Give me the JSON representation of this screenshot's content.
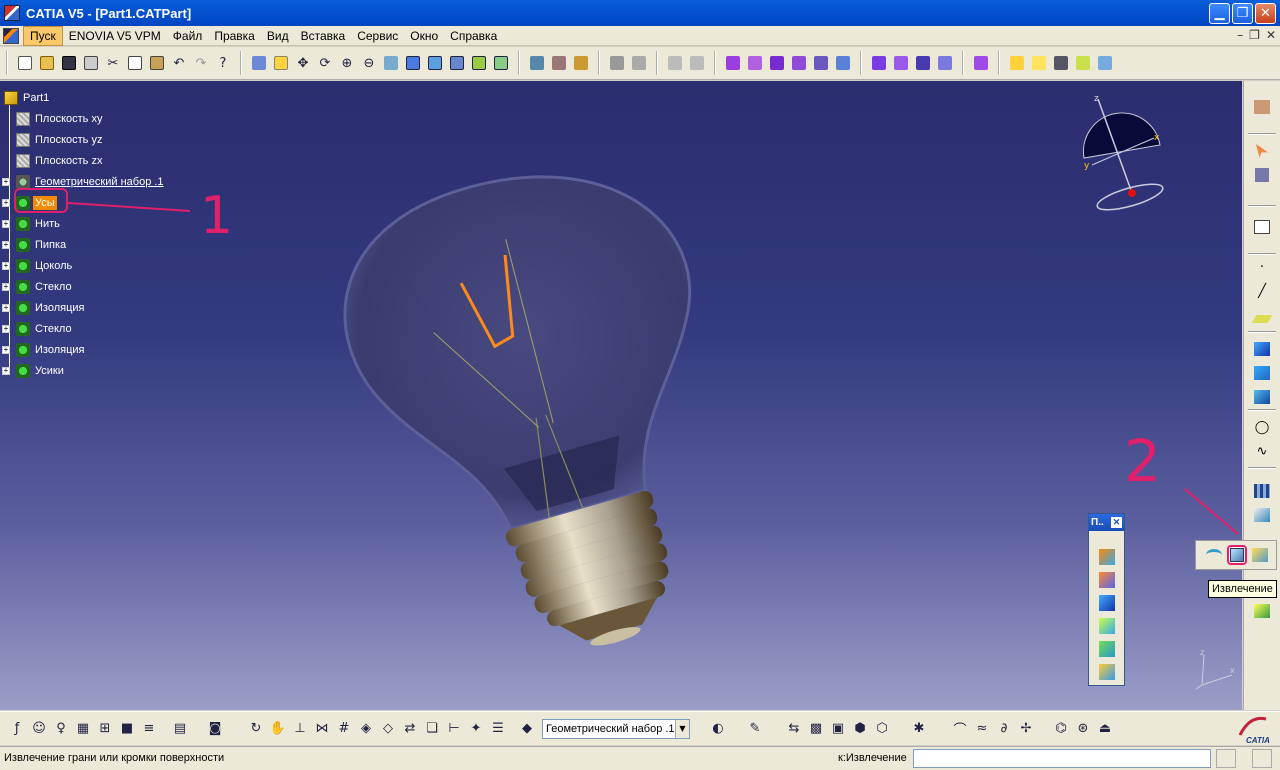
{
  "window": {
    "title": "CATIA V5 - [Part1.CATPart]",
    "buttons": {
      "minimize": "▁",
      "restore": "❐",
      "close": "✕"
    }
  },
  "menu": {
    "items": [
      "Пуск",
      "ENOVIA V5 VPM",
      "Файл",
      "Правка",
      "Вид",
      "Вставка",
      "Сервис",
      "Окно",
      "Справка"
    ],
    "active_index": 0,
    "mdi_buttons": [
      "–",
      "❐",
      "✕"
    ]
  },
  "tree": {
    "root": "Part1",
    "items": [
      {
        "label": "Плоскость xy",
        "kind": "plane"
      },
      {
        "label": "Плоскость yz",
        "kind": "plane"
      },
      {
        "label": "Плоскость zx",
        "kind": "plane"
      },
      {
        "label": "Геометрический набор .1",
        "kind": "geo",
        "underline": true
      },
      {
        "label": "Усы",
        "kind": "body",
        "selected": true
      },
      {
        "label": "Нить",
        "kind": "body"
      },
      {
        "label": "Пипка",
        "kind": "body"
      },
      {
        "label": "Цоколь",
        "kind": "body"
      },
      {
        "label": "Стекло",
        "kind": "body"
      },
      {
        "label": "Изоляция",
        "kind": "body"
      },
      {
        "label": "Стекло",
        "kind": "body"
      },
      {
        "label": "Изоляция",
        "kind": "body"
      },
      {
        "label": "Усики",
        "kind": "body"
      }
    ]
  },
  "annotations": {
    "one": "1",
    "two": "2"
  },
  "compass": {
    "z": "z",
    "x": "x",
    "y": "y"
  },
  "axis": {
    "z": "z",
    "x": "x"
  },
  "floating_toolbar": {
    "title": "П..",
    "close": "✕"
  },
  "tooltip": "Извлечение",
  "bottom": {
    "geometric_set_combo": "Геометрический набор .1"
  },
  "status": {
    "message": "Извлечение грани или кромки поверхности",
    "command_label": "к:Извлечение",
    "command_value": ""
  },
  "colors": {
    "selection": "#f18a00",
    "highlight": "#e0206a",
    "background_top": "#2a2d6e",
    "background_bottom": "#9c9ec8"
  }
}
